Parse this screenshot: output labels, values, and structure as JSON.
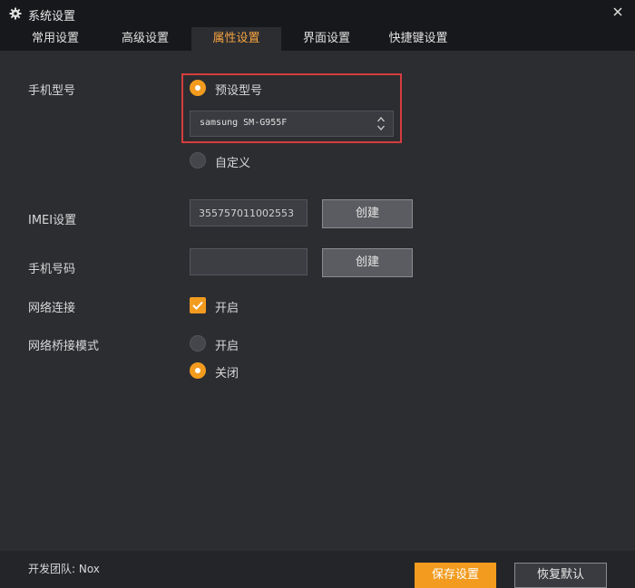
{
  "window": {
    "title": "系统设置"
  },
  "tabs": [
    {
      "label": "常用设置"
    },
    {
      "label": "高级设置"
    },
    {
      "label": "属性设置"
    },
    {
      "label": "界面设置"
    },
    {
      "label": "快捷键设置"
    }
  ],
  "active_tab": 2,
  "phone_model": {
    "label": "手机型号",
    "preset_label": "预设型号",
    "preset_selected": true,
    "selected_model": "samsung SM-G955F",
    "custom_label": "自定义"
  },
  "imei": {
    "label": "IMEI设置",
    "value": "355757011002553",
    "create_label": "创建"
  },
  "phone_number": {
    "label": "手机号码",
    "value": "",
    "create_label": "创建"
  },
  "network": {
    "label": "网络连接",
    "option_label": "开启",
    "checked": true
  },
  "bridge": {
    "label": "网络桥接模式",
    "on_label": "开启",
    "off_label": "关闭",
    "selected": "off"
  },
  "footer": {
    "team_text": "开发团队: Nox",
    "save_label": "保存设置",
    "restore_label": "恢复默认"
  },
  "colors": {
    "accent": "#f29b1e",
    "highlight_border": "#d53d3d"
  }
}
